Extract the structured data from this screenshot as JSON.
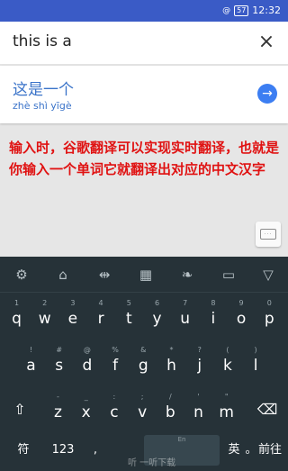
{
  "status_bar": {
    "mini_label": "@",
    "battery": "57",
    "time": "12:32"
  },
  "input": {
    "value": "this is a",
    "close_icon": "×"
  },
  "result": {
    "translation": "这是一个",
    "pinyin": "zhè shì yīgè",
    "go_icon": "→"
  },
  "annotation": "输入时，谷歌翻译可以实现实时翻译，也就是你输入一个单词它就翻译出对应的中文汉字",
  "keyboard": {
    "toggle_glyph": "...",
    "toolbar": [
      {
        "name": "settings-icon",
        "glyph": "⚙"
      },
      {
        "name": "theme-icon",
        "glyph": "⌂"
      },
      {
        "name": "cursor-icon",
        "glyph": "⇹"
      },
      {
        "name": "grid-icon",
        "glyph": "▦"
      },
      {
        "name": "leaf-icon",
        "glyph": "❧"
      },
      {
        "name": "comment-icon",
        "glyph": "▭"
      },
      {
        "name": "collapse-icon",
        "glyph": "▽"
      }
    ],
    "row1": [
      {
        "main": "q",
        "sub": "1"
      },
      {
        "main": "w",
        "sub": "2"
      },
      {
        "main": "e",
        "sub": "3"
      },
      {
        "main": "r",
        "sub": "4"
      },
      {
        "main": "t",
        "sub": "5"
      },
      {
        "main": "y",
        "sub": "6"
      },
      {
        "main": "u",
        "sub": "7"
      },
      {
        "main": "i",
        "sub": "8"
      },
      {
        "main": "o",
        "sub": "9"
      },
      {
        "main": "p",
        "sub": "0"
      }
    ],
    "row2": [
      {
        "main": "a",
        "sub": "!"
      },
      {
        "main": "s",
        "sub": "#"
      },
      {
        "main": "d",
        "sub": "@"
      },
      {
        "main": "f",
        "sub": "%"
      },
      {
        "main": "g",
        "sub": "&"
      },
      {
        "main": "h",
        "sub": "*"
      },
      {
        "main": "j",
        "sub": "?"
      },
      {
        "main": "k",
        "sub": "("
      },
      {
        "main": "l",
        "sub": ")"
      }
    ],
    "row3": [
      {
        "main": "z",
        "sub": "-"
      },
      {
        "main": "x",
        "sub": "_"
      },
      {
        "main": "c",
        "sub": ":"
      },
      {
        "main": "v",
        "sub": ";"
      },
      {
        "main": "b",
        "sub": "/"
      },
      {
        "main": "n",
        "sub": "'"
      },
      {
        "main": "m",
        "sub": "\""
      }
    ],
    "shift_icon": "⇧",
    "backspace_icon": "⌫",
    "symbol_label": "符",
    "num_label": "123",
    "comma_label": ",",
    "space_lang": "En",
    "space_label": "",
    "eng_label": "英",
    "period_label": "。",
    "go_label": "前往"
  },
  "watermark": "听 一听下载"
}
